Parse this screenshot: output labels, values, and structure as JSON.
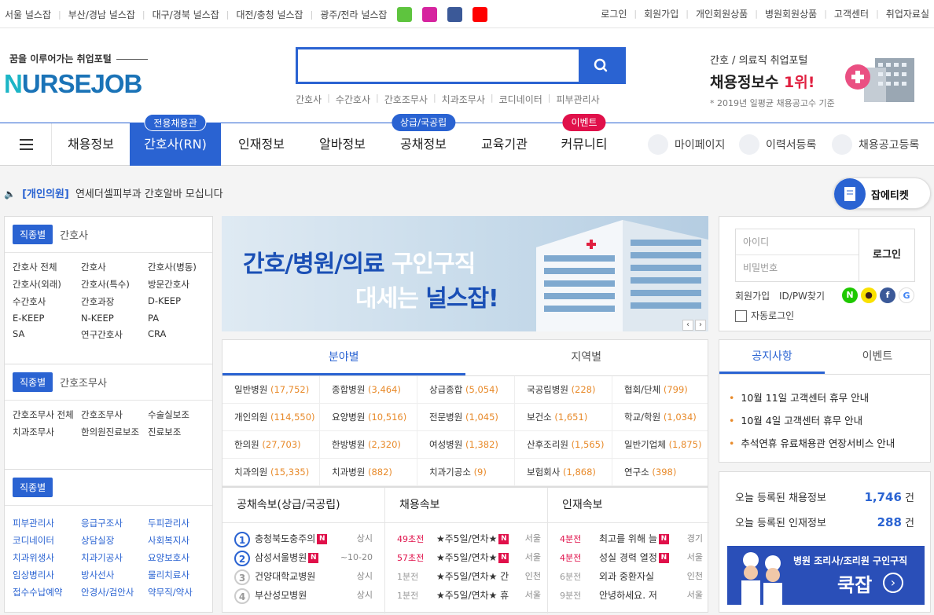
{
  "topbar": {
    "regions": [
      "서울 널스잡",
      "부산/경남 널스잡",
      "대구/경북 널스잡",
      "대전/충청 널스잡",
      "광주/전라 널스잡"
    ],
    "social": [
      "blog-icon",
      "instagram-icon",
      "facebook-icon",
      "youtube-icon"
    ],
    "social_colors": {
      "blog": "#5ec43e",
      "instagram": "#d6249f",
      "facebook": "#3b5998",
      "youtube": "#ff0000"
    },
    "links": [
      "로그인",
      "회원가입",
      "개인회원상품",
      "병원회원상품",
      "고객센터",
      "취업자료실"
    ]
  },
  "header": {
    "tagline": "꿈을 이루어가는 취업포털",
    "logo": "NURSEJOB",
    "search_placeholder": "",
    "quick": [
      "간호사",
      "수간호사",
      "간호조무사",
      "치과조무사",
      "코디네이터",
      "피부관리사"
    ],
    "promo_line1": "간호 / 의료직 취업포털",
    "promo_line2": "채용정보수",
    "promo_rank": "1위!",
    "promo_note": "* 2019년 일평균 채용공고수 기준"
  },
  "gnb": {
    "items": [
      "채용정보",
      "간호사(RN)",
      "인재정보",
      "알바정보",
      "공채정보",
      "교육기관",
      "커뮤니티"
    ],
    "badges": {
      "nurse": "전용채용관",
      "public": "상급/국공립",
      "community": "이벤트"
    },
    "util": [
      "마이페이지",
      "이력서등록",
      "채용공고등록"
    ],
    "accent": "#2a63d2"
  },
  "notice": {
    "category": "[개인의원]",
    "text": "연세더셀피부과 간호알바 모십니다"
  },
  "etiquette": "잡에티켓",
  "jobcats": [
    {
      "chip": "직종별",
      "name": "간호사",
      "items": [
        "간호사 전체",
        "간호사",
        "간호사(병동)",
        "간호사(외래)",
        "간호사(특수)",
        "방문간호사",
        "수간호사",
        "간호과장",
        "D-KEEP",
        "E-KEEP",
        "N-KEEP",
        "PA",
        "SA",
        "연구간호사",
        "CRA"
      ]
    },
    {
      "chip": "직종별",
      "name": "간호조무사",
      "items": [
        "간호조무사 전체",
        "간호조무사",
        "수술실보조",
        "치과조무사",
        "한의원진료보조",
        "진료보조"
      ]
    },
    {
      "chip": "직종별",
      "name": "",
      "items": [
        "피부관리사",
        "응급구조사",
        "두피관리사",
        "코디네이터",
        "상담실장",
        "사회복지사",
        "치과위생사",
        "치과기공사",
        "요양보호사",
        "임상병리사",
        "방사선사",
        "물리치료사",
        "접수수납예약",
        "안경사/검안사",
        "약무직/약사"
      ]
    }
  ],
  "banner": {
    "line1a": "간호/병원/의료",
    "line1b": " 구인구직",
    "line2a": "대세는 ",
    "line2b": "널스잡!"
  },
  "field_tabs": [
    "분야별",
    "지역별"
  ],
  "fields": [
    {
      "name": "일반병원",
      "count": "(17,752)"
    },
    {
      "name": "종합병원",
      "count": "(3,464)"
    },
    {
      "name": "상급종합",
      "count": "(5,054)"
    },
    {
      "name": "국공립병원",
      "count": "(228)"
    },
    {
      "name": "협회/단체",
      "count": "(799)"
    },
    {
      "name": "개인의원",
      "count": "(114,550)"
    },
    {
      "name": "요양병원",
      "count": "(10,516)"
    },
    {
      "name": "전문병원",
      "count": "(1,045)"
    },
    {
      "name": "보건소",
      "count": "(1,651)"
    },
    {
      "name": "학교/학원",
      "count": "(1,034)"
    },
    {
      "name": "한의원",
      "count": "(27,703)"
    },
    {
      "name": "한방병원",
      "count": "(2,320)"
    },
    {
      "name": "여성병원",
      "count": "(1,382)"
    },
    {
      "name": "산후조리원",
      "count": "(1,565)"
    },
    {
      "name": "일반기업체",
      "count": "(1,875)"
    },
    {
      "name": "치과의원",
      "count": "(15,335)"
    },
    {
      "name": "치과병원",
      "count": "(882)"
    },
    {
      "name": "치과기공소",
      "count": "(9)"
    },
    {
      "name": "보험회사",
      "count": "(1,868)"
    },
    {
      "name": "연구소",
      "count": "(398)"
    }
  ],
  "news": {
    "public": {
      "title": "공채속보(상급/국공립)",
      "rows": [
        {
          "n": "1",
          "name": "충청북도충주의",
          "meta": "상시"
        },
        {
          "n": "2",
          "name": "삼성서울병원",
          "meta": "~10-20"
        },
        {
          "n": "3",
          "name": "건양대학교병원",
          "meta": "상시"
        },
        {
          "n": "4",
          "name": "부산성모병원",
          "meta": "상시"
        }
      ]
    },
    "jobs": {
      "title": "채용속보",
      "rows": [
        {
          "t": "49초전",
          "name": "★주5일/연차★",
          "loc": "서울"
        },
        {
          "t": "57초전",
          "name": "★주5일/연차★",
          "loc": "서울"
        },
        {
          "t": "1분전",
          "name": "★주5일/연차★ 간",
          "loc": "인천"
        },
        {
          "t": "1분전",
          "name": "★주5일/연차★ 휴",
          "loc": "서울"
        }
      ]
    },
    "talent": {
      "title": "인재속보",
      "rows": [
        {
          "t": "4분전",
          "name": "최고를 위해 늘",
          "loc": "경기"
        },
        {
          "t": "4분전",
          "name": "성실 경력 열정",
          "loc": "서울"
        },
        {
          "t": "6분전",
          "name": "외과 중환자실",
          "loc": "인천"
        },
        {
          "t": "9분전",
          "name": "안녕하세요. 저",
          "loc": "서울"
        }
      ]
    }
  },
  "login": {
    "id_placeholder": "아이디",
    "pw_placeholder": "비밀번호",
    "button": "로그인",
    "join": "회원가입",
    "find": "ID/PW찾기",
    "auto": "자동로그인"
  },
  "notice_tabs": [
    "공지사항",
    "이벤트"
  ],
  "notices": [
    "10월 11일 고객센터 휴무 안내",
    "10월 4일 고객센터 휴무 안내",
    "추석연휴 유료채용관 연장서비스 안내"
  ],
  "stats": {
    "jobs_label": "오늘 등록된 채용정보",
    "jobs_value": "1,746",
    "talent_label": "오늘 등록된 인재정보",
    "talent_value": "288",
    "unit": "건"
  },
  "ad": {
    "line1": "병원 조리사/조리원 구인구직",
    "line2": "쿡잡"
  }
}
